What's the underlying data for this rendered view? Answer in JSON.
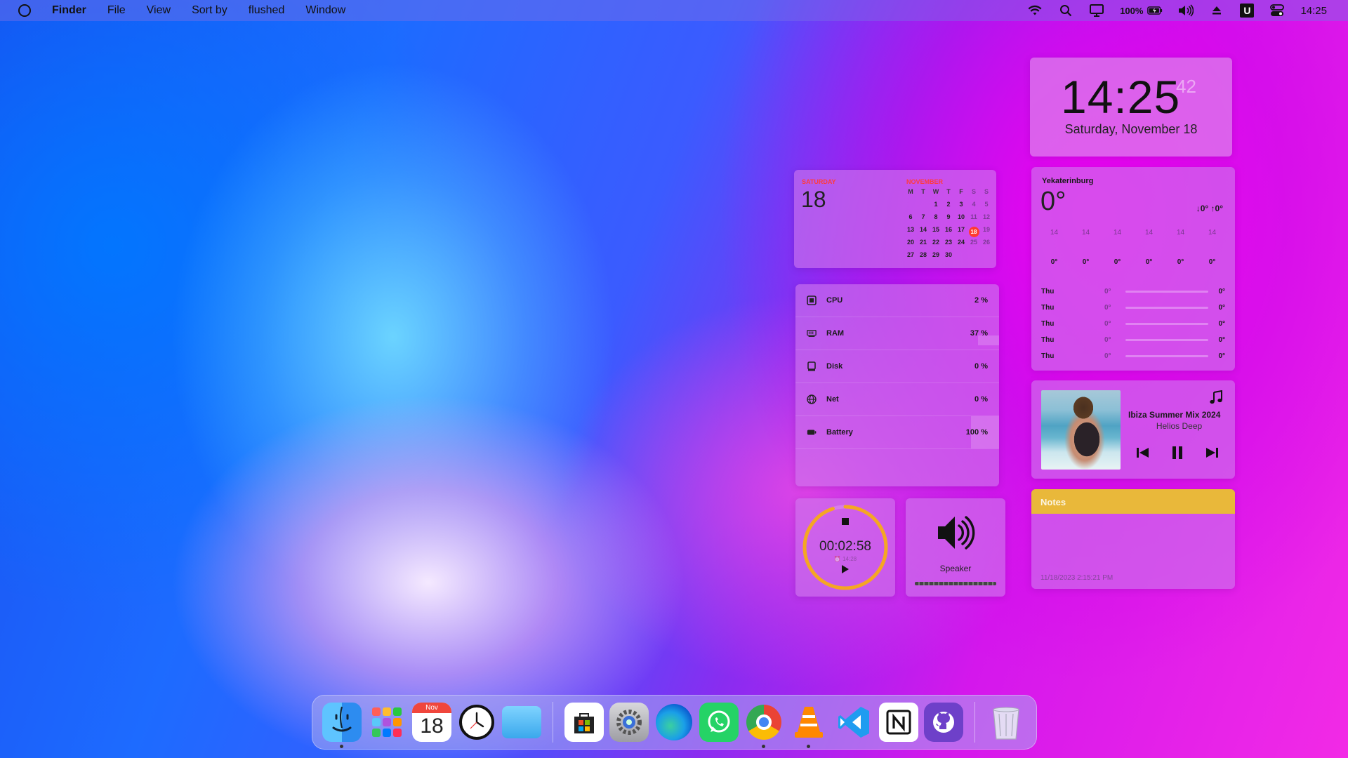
{
  "menubar": {
    "app_name": "Finder",
    "menus": [
      "File",
      "View",
      "Sort by",
      "flushed",
      "Window"
    ],
    "battery_percent": "100%",
    "user_initial": "U",
    "time": "14:25",
    "icons": [
      "wifi-icon",
      "search-icon",
      "display-icon",
      "battery-icon",
      "volume-icon",
      "eject-icon",
      "user-icon",
      "control-center-icon"
    ]
  },
  "clock": {
    "time": "14:25",
    "seconds": "42",
    "date": "Saturday, November 18"
  },
  "calendar": {
    "day_name": "SATURDAY",
    "day_number": "18",
    "month": "NOVEMBER",
    "weekdays": [
      "M",
      "T",
      "W",
      "T",
      "F",
      "S",
      "S"
    ],
    "weeks": [
      [
        "",
        "",
        "1",
        "2",
        "3",
        "4",
        "5"
      ],
      [
        "6",
        "7",
        "8",
        "9",
        "10",
        "11",
        "12"
      ],
      [
        "13",
        "14",
        "15",
        "16",
        "17",
        "18",
        "19"
      ],
      [
        "20",
        "21",
        "22",
        "23",
        "24",
        "25",
        "26"
      ],
      [
        "27",
        "28",
        "29",
        "30",
        "",
        "",
        ""
      ]
    ],
    "today": "18"
  },
  "weather": {
    "city": "Yekaterinburg",
    "temp": "0°",
    "low_high": "↓0° ↑0°",
    "hours": [
      "14",
      "14",
      "14",
      "14",
      "14",
      "14"
    ],
    "hour_temps": [
      "0°",
      "0°",
      "0°",
      "0°",
      "0°",
      "0°"
    ],
    "days": [
      {
        "name": "Thu",
        "low": "0°",
        "high": "0°"
      },
      {
        "name": "Thu",
        "low": "0°",
        "high": "0°"
      },
      {
        "name": "Thu",
        "low": "0°",
        "high": "0°"
      },
      {
        "name": "Thu",
        "low": "0°",
        "high": "0°"
      },
      {
        "name": "Thu",
        "low": "0°",
        "high": "0°"
      }
    ]
  },
  "stats": {
    "rows": [
      {
        "label": "CPU",
        "value": "2 %",
        "icon": "cpu-icon",
        "fill": 0.02
      },
      {
        "label": "RAM",
        "value": "37 %",
        "icon": "ram-icon",
        "fill": 0.37
      },
      {
        "label": "Disk",
        "value": "0 %",
        "icon": "disk-icon",
        "fill": 0
      },
      {
        "label": "Net",
        "value": "0 %",
        "icon": "globe-icon",
        "fill": 0
      },
      {
        "label": "Battery",
        "value": "100 %",
        "icon": "battery-icon",
        "fill": 1.0
      }
    ]
  },
  "timer": {
    "time": "00:02:58",
    "alarm": "⏰ 14:28",
    "progress": 0.95,
    "ring_color": "#f5a623"
  },
  "speaker": {
    "label": "Speaker"
  },
  "music": {
    "title": "Ibiza Summer Mix 2024",
    "artist": "Helios Deep"
  },
  "notes": {
    "title": "Notes",
    "timestamp": "11/18/2023 2:15:21 PM"
  },
  "dock": {
    "apps": [
      "Finder",
      "Launchpad",
      "Calendar",
      "Clock",
      "Files",
      "Microsoft Store",
      "Settings",
      "Edge",
      "WhatsApp",
      "Chrome",
      "VLC",
      "VS Code",
      "Notion",
      "GitHub Desktop",
      "Trash"
    ],
    "calendar_month": "Nov",
    "calendar_day": "18"
  },
  "colors": {
    "accent_red": "#ff3b30",
    "notes_header": "#e9b83a",
    "timer_ring": "#f5a623"
  }
}
